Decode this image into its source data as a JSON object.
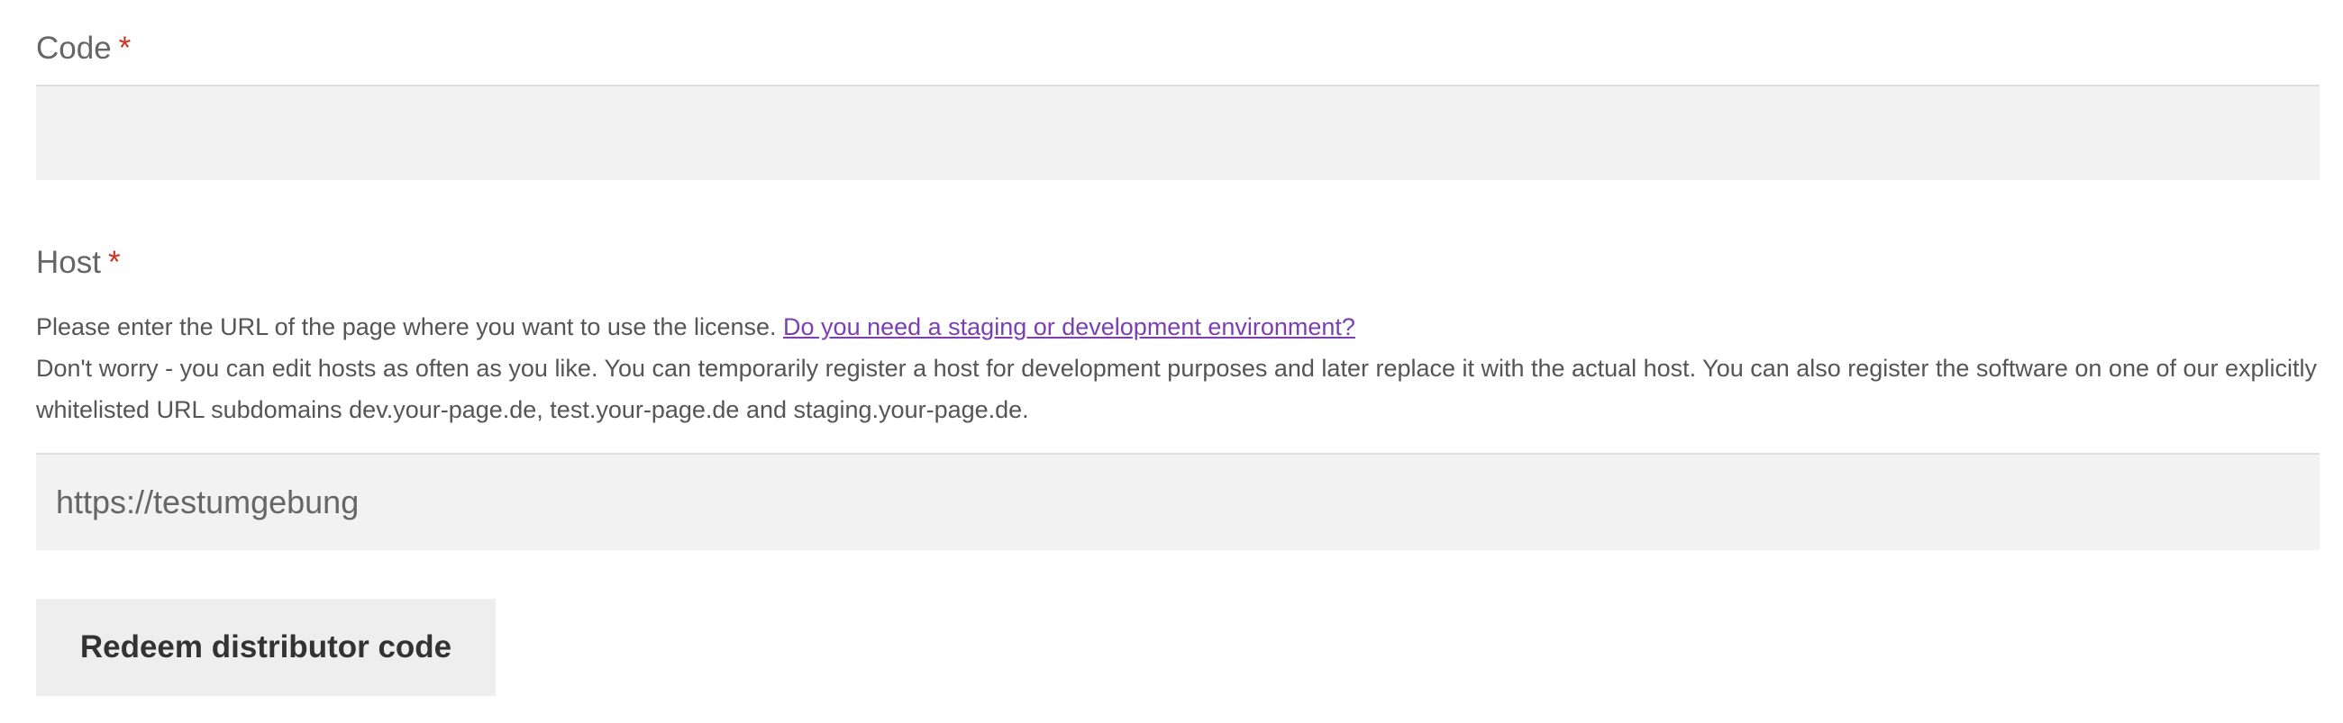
{
  "code": {
    "label": "Code",
    "required_marker": "*",
    "value": ""
  },
  "host": {
    "label": "Host",
    "required_marker": "*",
    "help_line1": "Please enter the URL of the page where you want to use the license.",
    "help_link": "Do you need a staging or development environment?",
    "help_line2": "Don't worry - you can edit hosts as often as you like. You can temporarily register a host for development purposes and later replace it with the actual host. You can also register the software on one of our explicitly whitelisted URL subdomains dev.your-page.de, test.your-page.de and staging.your-page.de.",
    "value": "https://testumgebung"
  },
  "submit": {
    "label": "Redeem distributor code"
  },
  "colors": {
    "required": "#d0341f",
    "link": "#7b3fb0",
    "field_bg": "#f2f2f2",
    "button_bg": "#eeeeee"
  }
}
